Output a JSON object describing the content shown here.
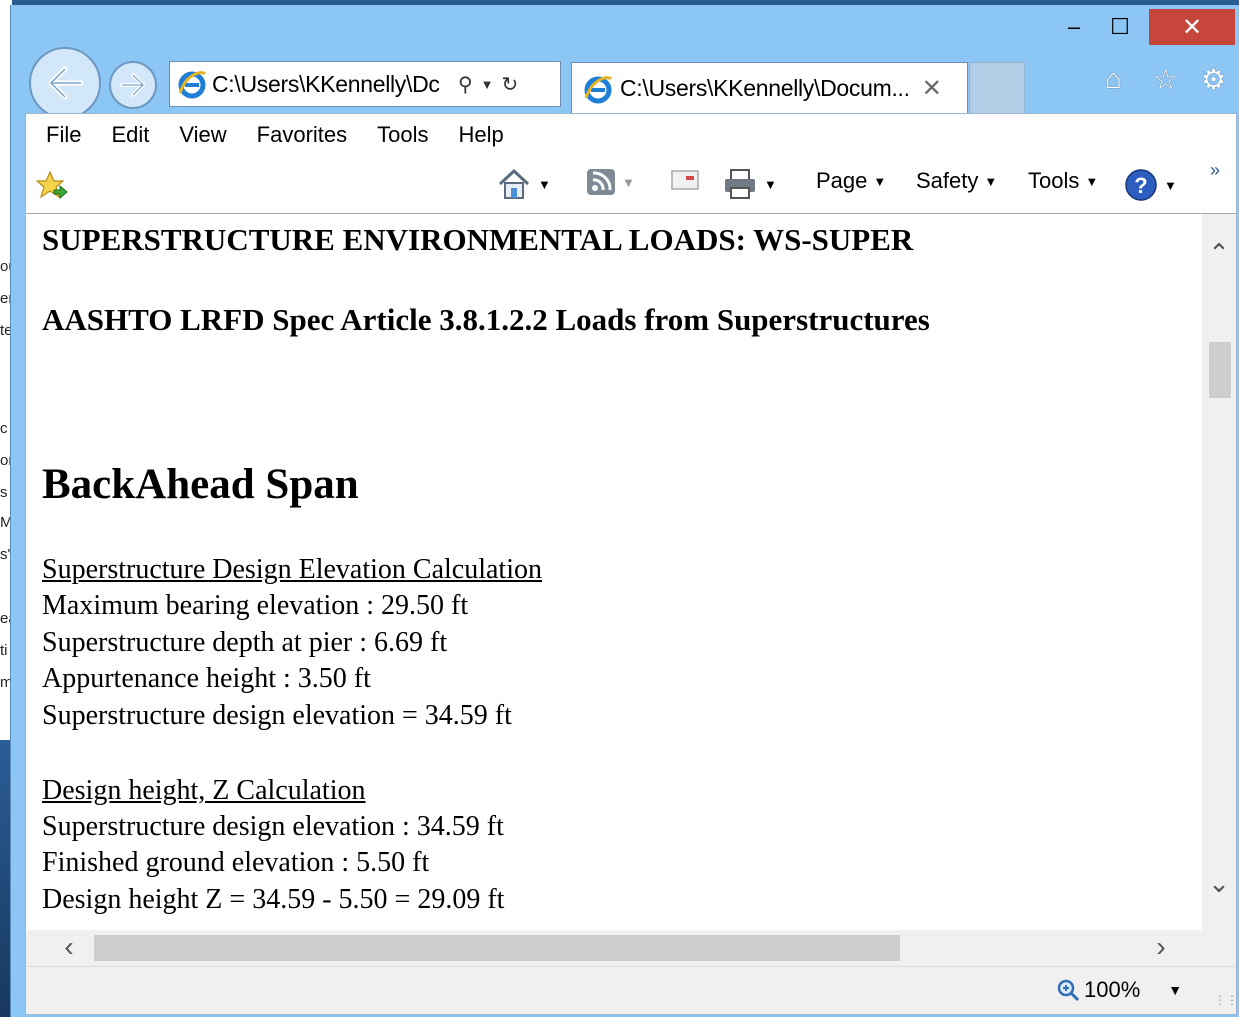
{
  "background_fragments": [
    "ou",
    "er",
    "te",
    "c",
    "or",
    "s",
    "M",
    "s'",
    "ea",
    "ti",
    "m"
  ],
  "window": {
    "controls": {
      "minimize": "–",
      "maximize": "☐",
      "close": "✕"
    },
    "address_bar": {
      "url": "C:\\Users\\KKennelly\\Dc",
      "search_icon": "search-icon",
      "refresh_icon": "refresh-icon"
    },
    "tab": {
      "title": "C:\\Users\\KKennelly\\Docum...",
      "close": "✕"
    },
    "menu": [
      "File",
      "Edit",
      "View",
      "Favorites",
      "Tools",
      "Help"
    ],
    "command_bar": {
      "page": "Page",
      "safety": "Safety",
      "tools": "Tools"
    },
    "status": {
      "zoom": "100%"
    }
  },
  "document": {
    "heading1": "SUPERSTRUCTURE ENVIRONMENTAL LOADS: WS-SUPER",
    "heading2": "AASHTO LRFD Spec Article 3.8.1.2.2 Loads from Superstructures",
    "span_title": "BackAhead Span",
    "elevation_section": {
      "title": "Superstructure Design Elevation Calculation",
      "lines": [
        "Maximum bearing elevation : 29.50 ft",
        "Superstructure depth at pier : 6.69 ft",
        "Appurtenance height : 3.50 ft",
        "Superstructure design elevation = 34.59 ft"
      ]
    },
    "height_section": {
      "title": "Design height, Z Calculation",
      "lines": [
        "Superstructure design elevation : 34.59 ft",
        "Finished ground elevation : 5.50 ft",
        "Design height Z = 34.59 - 5.50 = 29.09 ft"
      ]
    }
  },
  "colors": {
    "frame": "#8cc6f4",
    "close": "#c7463c",
    "text": "#000000"
  }
}
